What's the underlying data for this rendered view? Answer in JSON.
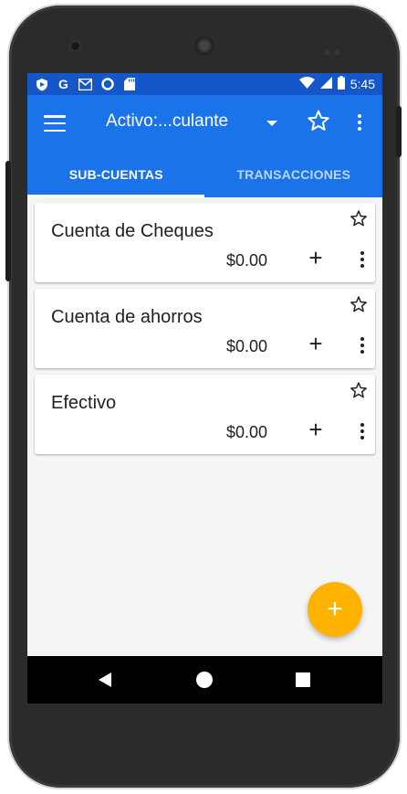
{
  "status_bar": {
    "time": "5:45",
    "left_icons": [
      "shield-icon",
      "google-icon",
      "gmail-icon",
      "circle-icon",
      "sd-card-icon"
    ],
    "right_icons": [
      "wifi-icon",
      "signal-icon",
      "battery-icon"
    ]
  },
  "toolbar": {
    "title": "Activo:...culante",
    "icons": [
      "menu-icon",
      "dropdown-arrow-icon",
      "star-outline-icon",
      "more-vert-icon"
    ]
  },
  "tabs": [
    {
      "label": "SUB-CUENTAS",
      "active": true
    },
    {
      "label": "TRANSACCIONES",
      "active": false
    }
  ],
  "accounts": [
    {
      "name": "Cuenta de Cheques",
      "balance": "$0.00",
      "favorite": false
    },
    {
      "name": "Cuenta de ahorros",
      "balance": "$0.00",
      "favorite": false
    },
    {
      "name": "Efectivo",
      "balance": "$0.00",
      "favorite": false
    }
  ],
  "card_actions": {
    "add_symbol": "+"
  },
  "fab": {
    "symbol": "+",
    "color": "#ffb300"
  },
  "colors": {
    "primary": "#1a73e8",
    "status_bar": "#1556c9",
    "background": "#f5f5f5"
  }
}
